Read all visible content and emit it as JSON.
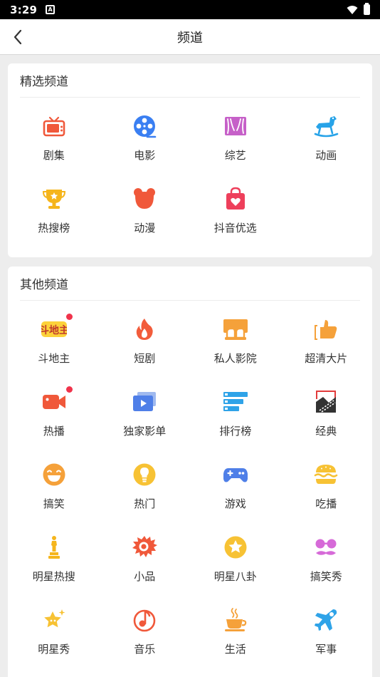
{
  "status_bar": {
    "time": "3:29",
    "notif_icon": "notification-a-icon"
  },
  "header": {
    "title": "频道"
  },
  "featured": {
    "title": "精选频道",
    "items": [
      {
        "label": "剧集",
        "icon": "tv-icon"
      },
      {
        "label": "电影",
        "icon": "film-reel-icon"
      },
      {
        "label": "综艺",
        "icon": "stage-curtain-icon"
      },
      {
        "label": "动画",
        "icon": "rocking-horse-icon"
      },
      {
        "label": "热搜榜",
        "icon": "trophy-icon"
      },
      {
        "label": "动漫",
        "icon": "bear-icon"
      },
      {
        "label": "抖音优选",
        "icon": "shopping-bag-icon"
      }
    ]
  },
  "others": {
    "title": "其他频道",
    "items": [
      {
        "label": "斗地主",
        "icon": "doudizhu-logo",
        "logo_text": "斗地主",
        "badge": true
      },
      {
        "label": "短剧",
        "icon": "flame-icon"
      },
      {
        "label": "私人影院",
        "icon": "private-cinema-icon"
      },
      {
        "label": "超清大片",
        "icon": "thumbs-up-icon"
      },
      {
        "label": "热播",
        "icon": "video-camera-icon",
        "badge": true
      },
      {
        "label": "独家影单",
        "icon": "playlist-icon"
      },
      {
        "label": "排行榜",
        "icon": "ranking-list-icon"
      },
      {
        "label": "经典",
        "icon": "classic-film-icon"
      },
      {
        "label": "搞笑",
        "icon": "laughing-face-icon"
      },
      {
        "label": "热门",
        "icon": "lightbulb-icon"
      },
      {
        "label": "游戏",
        "icon": "gamepad-icon"
      },
      {
        "label": "吃播",
        "icon": "burger-icon"
      },
      {
        "label": "明星热搜",
        "icon": "oscar-statue-icon"
      },
      {
        "label": "小品",
        "icon": "lion-mask-icon"
      },
      {
        "label": "明星八卦",
        "icon": "star-badge-icon"
      },
      {
        "label": "搞笑秀",
        "icon": "glasses-mustache-icon"
      },
      {
        "label": "明星秀",
        "icon": "sparkle-star-icon"
      },
      {
        "label": "音乐",
        "icon": "music-note-icon"
      },
      {
        "label": "生活",
        "icon": "coffee-cup-icon"
      },
      {
        "label": "军事",
        "icon": "military-plane-icon"
      }
    ]
  }
}
